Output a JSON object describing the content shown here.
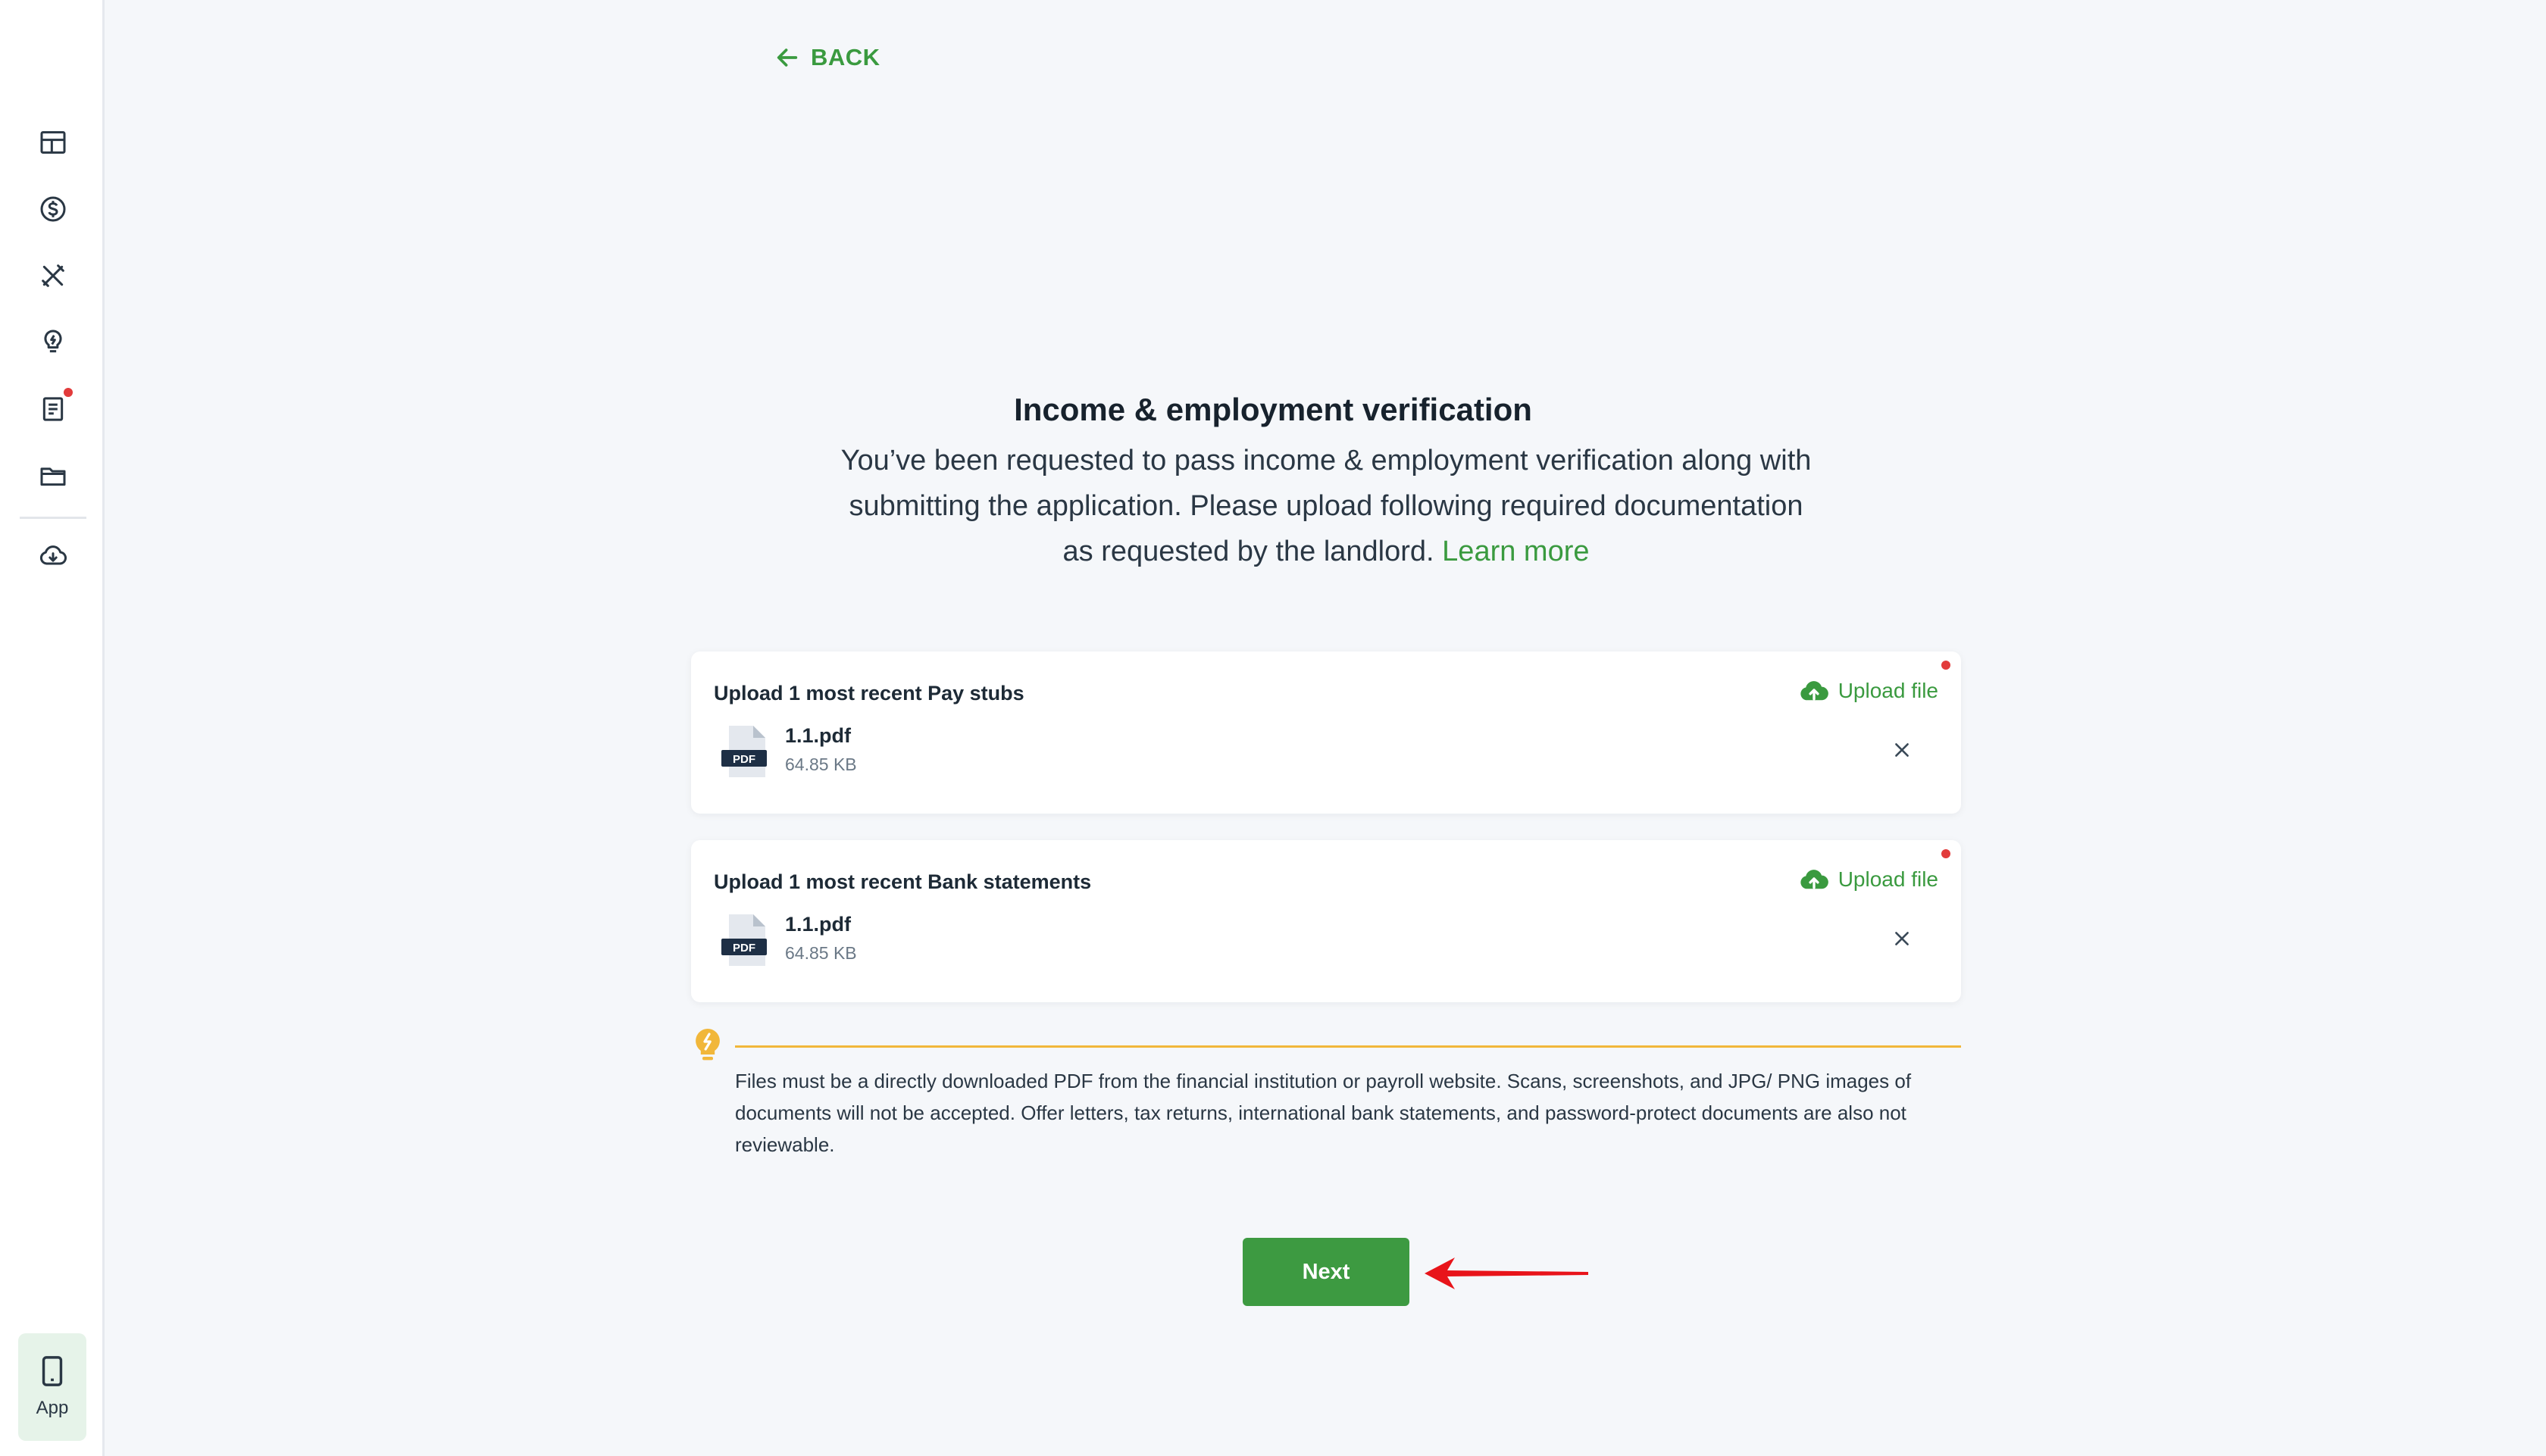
{
  "sidebar": {
    "items": [
      {
        "icon": "dashboard-icon"
      },
      {
        "icon": "dollar-circle-icon"
      },
      {
        "icon": "tools-icon"
      },
      {
        "icon": "lightbulb-icon"
      },
      {
        "icon": "document-icon",
        "has_notification": true
      },
      {
        "icon": "folder-icon"
      },
      {
        "icon": "cloud-download-icon"
      }
    ],
    "app_label": "App"
  },
  "header": {
    "back_label": "BACK"
  },
  "main": {
    "title": "Income & employment verification",
    "intro_text": "You’ve been requested to pass income & employment verification along with submitting the application. Please upload following required documentation as requested by the landlord.",
    "learn_more_label": "Learn more",
    "uploads": [
      {
        "title": "Upload 1 most recent Pay stubs",
        "upload_label": "Upload file",
        "file": {
          "name": "1.1.pdf",
          "size": "64.85 KB",
          "type_label": "PDF"
        }
      },
      {
        "title": "Upload 1 most recent Bank statements",
        "upload_label": "Upload file",
        "file": {
          "name": "1.1.pdf",
          "size": "64.85 KB",
          "type_label": "PDF"
        }
      }
    ],
    "notice": "Files must be a directly downloaded PDF from the financial institution or payroll website. Scans, screenshots, and JPG/ PNG images of documents will not be accepted. Offer letters, tax returns, international bank statements, and password-protect documents are also not reviewable.",
    "next_label": "Next"
  },
  "colors": {
    "accent_green": "#3a9a3f",
    "button_green": "#3d9a41",
    "alert_red": "#e23b3b",
    "notice_yellow": "#f1b73a",
    "background": "#f5f7fa"
  }
}
